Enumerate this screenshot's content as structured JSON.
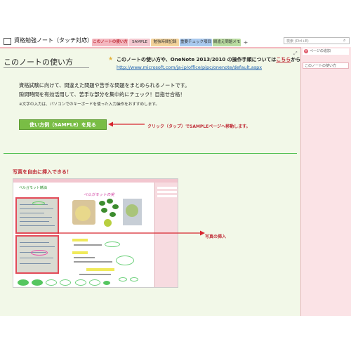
{
  "notebook": {
    "title": "資格勉強ノート（タッチ対応）",
    "dropdown_glyph": "▾"
  },
  "tabs": [
    {
      "label": "このノートの使い方",
      "color": "#f4b8c0"
    },
    {
      "label": "SAMPLE",
      "color": "#f3c7cf"
    },
    {
      "label": "勉強時間記録",
      "color": "#f3d29a"
    },
    {
      "label": "重要チェック項目",
      "color": "#a9c9ee"
    },
    {
      "label": "間違え問題メモ",
      "color": "#b9dba0"
    }
  ],
  "tab_add_label": "+",
  "search": {
    "placeholder": "検索 (Ctrl+E)"
  },
  "sidebar": {
    "add_page_label": "ページの追加",
    "pages": [
      "このノートの使い方"
    ]
  },
  "page": {
    "title": "このノートの使い方",
    "info_text": "このノートの使い方や、OneNote 2013/2010 の操作手順については",
    "info_link": "こちら",
    "info_suffix": "から",
    "url": "http://www.microsoft.com/ja-jp/office/pipc/onenote/default.aspx",
    "desc_line1": "資格試験に向けて、間違えた問題や苦手な問題をまとめられるノートです。",
    "desc_line2": "隙間時間を有効活用して、苦手な部分を集中的にチェック！目指せ合格！",
    "desc_line3": "※文字の入力は、パソコンでのキーボードを使った入力操作をおすすめします。",
    "sample_button": "使い方例（SAMPLE）を見る",
    "annotation_click": "クリック（タップ）でSAMPLEページへ移動します。",
    "photo_label": "写真を自由に挿入できる！",
    "annotation_photo": "写真の挿入",
    "sample_image": {
      "title": "ベルガモット精油",
      "handwriting": "ベルガモットの実"
    }
  },
  "colors": {
    "accent_red": "#c0303a",
    "button_green": "#79bd45",
    "page_bg": "#f2f8e8",
    "sidebar_bg": "#fbe3e6",
    "divider_green": "#4cbf4c",
    "link_blue": "#1a5fb0"
  },
  "icons": {
    "notebook": "notebook-icon",
    "star": "star-icon",
    "search": "search-icon",
    "add_page": "plus-circle-icon",
    "resize": "expand-icon"
  }
}
